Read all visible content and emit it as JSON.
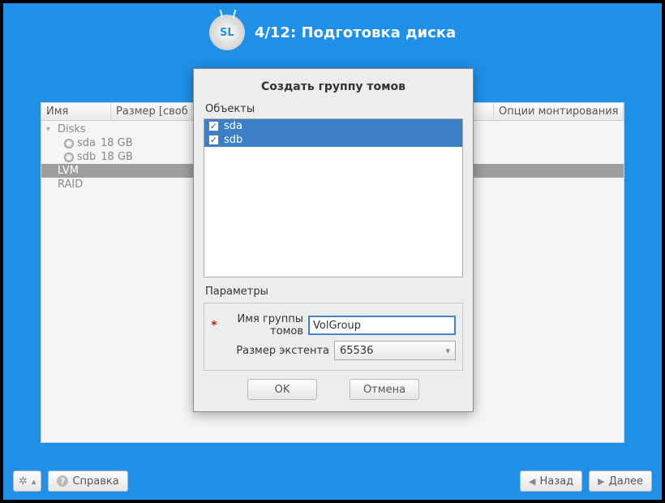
{
  "header": {
    "step": "4/12: Подготовка диска",
    "logo_text": "SL"
  },
  "table": {
    "col_name": "Имя",
    "col_size": "Размер [своб",
    "col_mount": "Опции монтирования"
  },
  "tree": {
    "disks_label": "Disks",
    "disks": [
      {
        "name": "sda",
        "size": "18 GB"
      },
      {
        "name": "sdb",
        "size": "18 GB"
      }
    ],
    "lvm_label": "LVM",
    "raid_label": "RAID"
  },
  "modal": {
    "title": "Создать группу томов",
    "objects_label": "Объекты",
    "objects": [
      {
        "label": "sda",
        "checked": true
      },
      {
        "label": "sdb",
        "checked": true
      }
    ],
    "params_label": "Параметры",
    "vg_name_label": "Имя группы томов",
    "vg_name_value": "VolGroup",
    "extent_label": "Размер экстента",
    "extent_value": "65536",
    "ok": "OK",
    "cancel": "Отмена"
  },
  "footer": {
    "help": "Справка",
    "back": "Назад",
    "next": "Далее"
  }
}
